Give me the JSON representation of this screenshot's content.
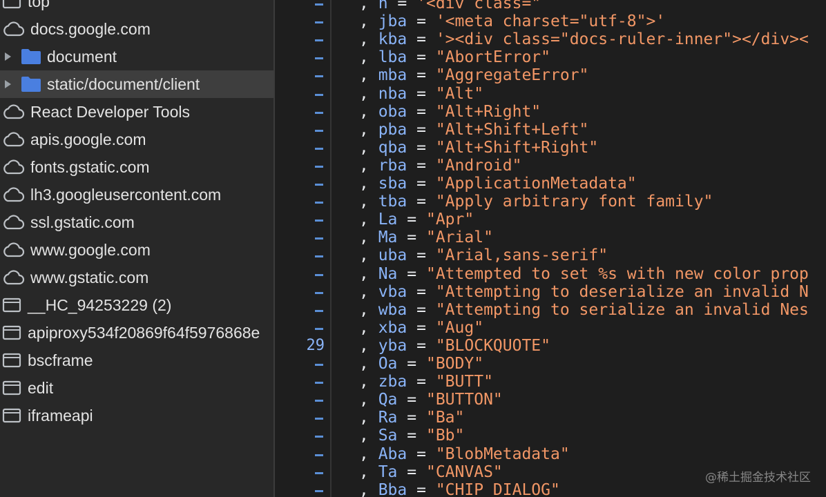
{
  "sidebar": {
    "items": [
      {
        "label": "top",
        "icon": "frame-icon",
        "expandable": false,
        "selected": false
      },
      {
        "label": "docs.google.com",
        "icon": "cloud-icon",
        "expandable": false,
        "selected": false
      },
      {
        "label": "document",
        "icon": "folder-icon",
        "expandable": true,
        "selected": false
      },
      {
        "label": "static/document/client",
        "icon": "folder-icon",
        "expandable": true,
        "selected": true
      },
      {
        "label": "React Developer Tools",
        "icon": "cloud-icon",
        "expandable": false,
        "selected": false
      },
      {
        "label": "apis.google.com",
        "icon": "cloud-icon",
        "expandable": false,
        "selected": false
      },
      {
        "label": "fonts.gstatic.com",
        "icon": "cloud-icon",
        "expandable": false,
        "selected": false
      },
      {
        "label": "lh3.googleusercontent.com",
        "icon": "cloud-icon",
        "expandable": false,
        "selected": false
      },
      {
        "label": "ssl.gstatic.com",
        "icon": "cloud-icon",
        "expandable": false,
        "selected": false
      },
      {
        "label": "www.google.com",
        "icon": "cloud-icon",
        "expandable": false,
        "selected": false
      },
      {
        "label": "www.gstatic.com",
        "icon": "cloud-icon",
        "expandable": false,
        "selected": false
      },
      {
        "label": "__HC_94253229 (2)",
        "icon": "frame-icon",
        "expandable": false,
        "selected": false
      },
      {
        "label": "apiproxy534f20869f64f5976868e",
        "icon": "frame-icon",
        "expandable": false,
        "selected": false
      },
      {
        "label": "bscframe",
        "icon": "frame-icon",
        "expandable": false,
        "selected": false
      },
      {
        "label": "edit",
        "icon": "frame-icon",
        "expandable": false,
        "selected": false
      },
      {
        "label": "iframeapi",
        "icon": "frame-icon",
        "expandable": false,
        "selected": false
      }
    ]
  },
  "editor": {
    "lines": [
      {
        "gutter": "–",
        "name": "h",
        "value": "'<div class=\"",
        "sep": "="
      },
      {
        "gutter": "–",
        "name": "jba",
        "value": "'<meta charset=\"utf-8\">'",
        "sep": "="
      },
      {
        "gutter": "–",
        "name": "kba",
        "value": "'><div class=\"docs-ruler-inner\"></div><",
        "sep": "="
      },
      {
        "gutter": "–",
        "name": "lba",
        "value": "\"AbortError\"",
        "sep": "="
      },
      {
        "gutter": "–",
        "name": "mba",
        "value": "\"AggregateError\"",
        "sep": "="
      },
      {
        "gutter": "–",
        "name": "nba",
        "value": "\"Alt\"",
        "sep": "="
      },
      {
        "gutter": "–",
        "name": "oba",
        "value": "\"Alt+Right\"",
        "sep": "="
      },
      {
        "gutter": "–",
        "name": "pba",
        "value": "\"Alt+Shift+Left\"",
        "sep": "="
      },
      {
        "gutter": "–",
        "name": "qba",
        "value": "\"Alt+Shift+Right\"",
        "sep": "="
      },
      {
        "gutter": "–",
        "name": "rba",
        "value": "\"Android\"",
        "sep": "="
      },
      {
        "gutter": "–",
        "name": "sba",
        "value": "\"ApplicationMetadata\"",
        "sep": "="
      },
      {
        "gutter": "–",
        "name": "tba",
        "value": "\"Apply arbitrary font family\"",
        "sep": "="
      },
      {
        "gutter": "–",
        "name": "La",
        "value": "\"Apr\"",
        "sep": "="
      },
      {
        "gutter": "–",
        "name": "Ma",
        "value": "\"Arial\"",
        "sep": "="
      },
      {
        "gutter": "–",
        "name": "uba",
        "value": "\"Arial,sans-serif\"",
        "sep": "="
      },
      {
        "gutter": "–",
        "name": "Na",
        "value": "\"Attempted to set %s with new color prop",
        "sep": "="
      },
      {
        "gutter": "–",
        "name": "vba",
        "value": "\"Attempting to deserialize an invalid N",
        "sep": "="
      },
      {
        "gutter": "–",
        "name": "wba",
        "value": "\"Attempting to serialize an invalid Nes",
        "sep": "="
      },
      {
        "gutter": "–",
        "name": "xba",
        "value": "\"Aug\"",
        "sep": "="
      },
      {
        "gutter": "29",
        "name": "yba",
        "value": "\"BLOCKQUOTE\"",
        "sep": "="
      },
      {
        "gutter": "–",
        "name": "Oa",
        "value": "\"BODY\"",
        "sep": "="
      },
      {
        "gutter": "–",
        "name": "zba",
        "value": "\"BUTT\"",
        "sep": "="
      },
      {
        "gutter": "–",
        "name": "Qa",
        "value": "\"BUTTON\"",
        "sep": "="
      },
      {
        "gutter": "–",
        "name": "Ra",
        "value": "\"Ba\"",
        "sep": "="
      },
      {
        "gutter": "–",
        "name": "Sa",
        "value": "\"Bb\"",
        "sep": "="
      },
      {
        "gutter": "–",
        "name": "Aba",
        "value": "\"BlobMetadata\"",
        "sep": "="
      },
      {
        "gutter": "–",
        "name": "Ta",
        "value": "\"CANVAS\"",
        "sep": "="
      },
      {
        "gutter": "–",
        "name": "Bba",
        "value": "\"CHIP_DIALOG\"",
        "sep": "="
      }
    ]
  },
  "watermark": "@稀土掘金技术社区",
  "colors": {
    "identifier": "#8ab4f8",
    "string": "#f29766",
    "punctuation": "#e8eaed",
    "sidebar_bg": "#282828",
    "selected_bg": "#3e3e3e",
    "folder": "#4a7fe0",
    "editor_bg": "#1e1e1e"
  }
}
